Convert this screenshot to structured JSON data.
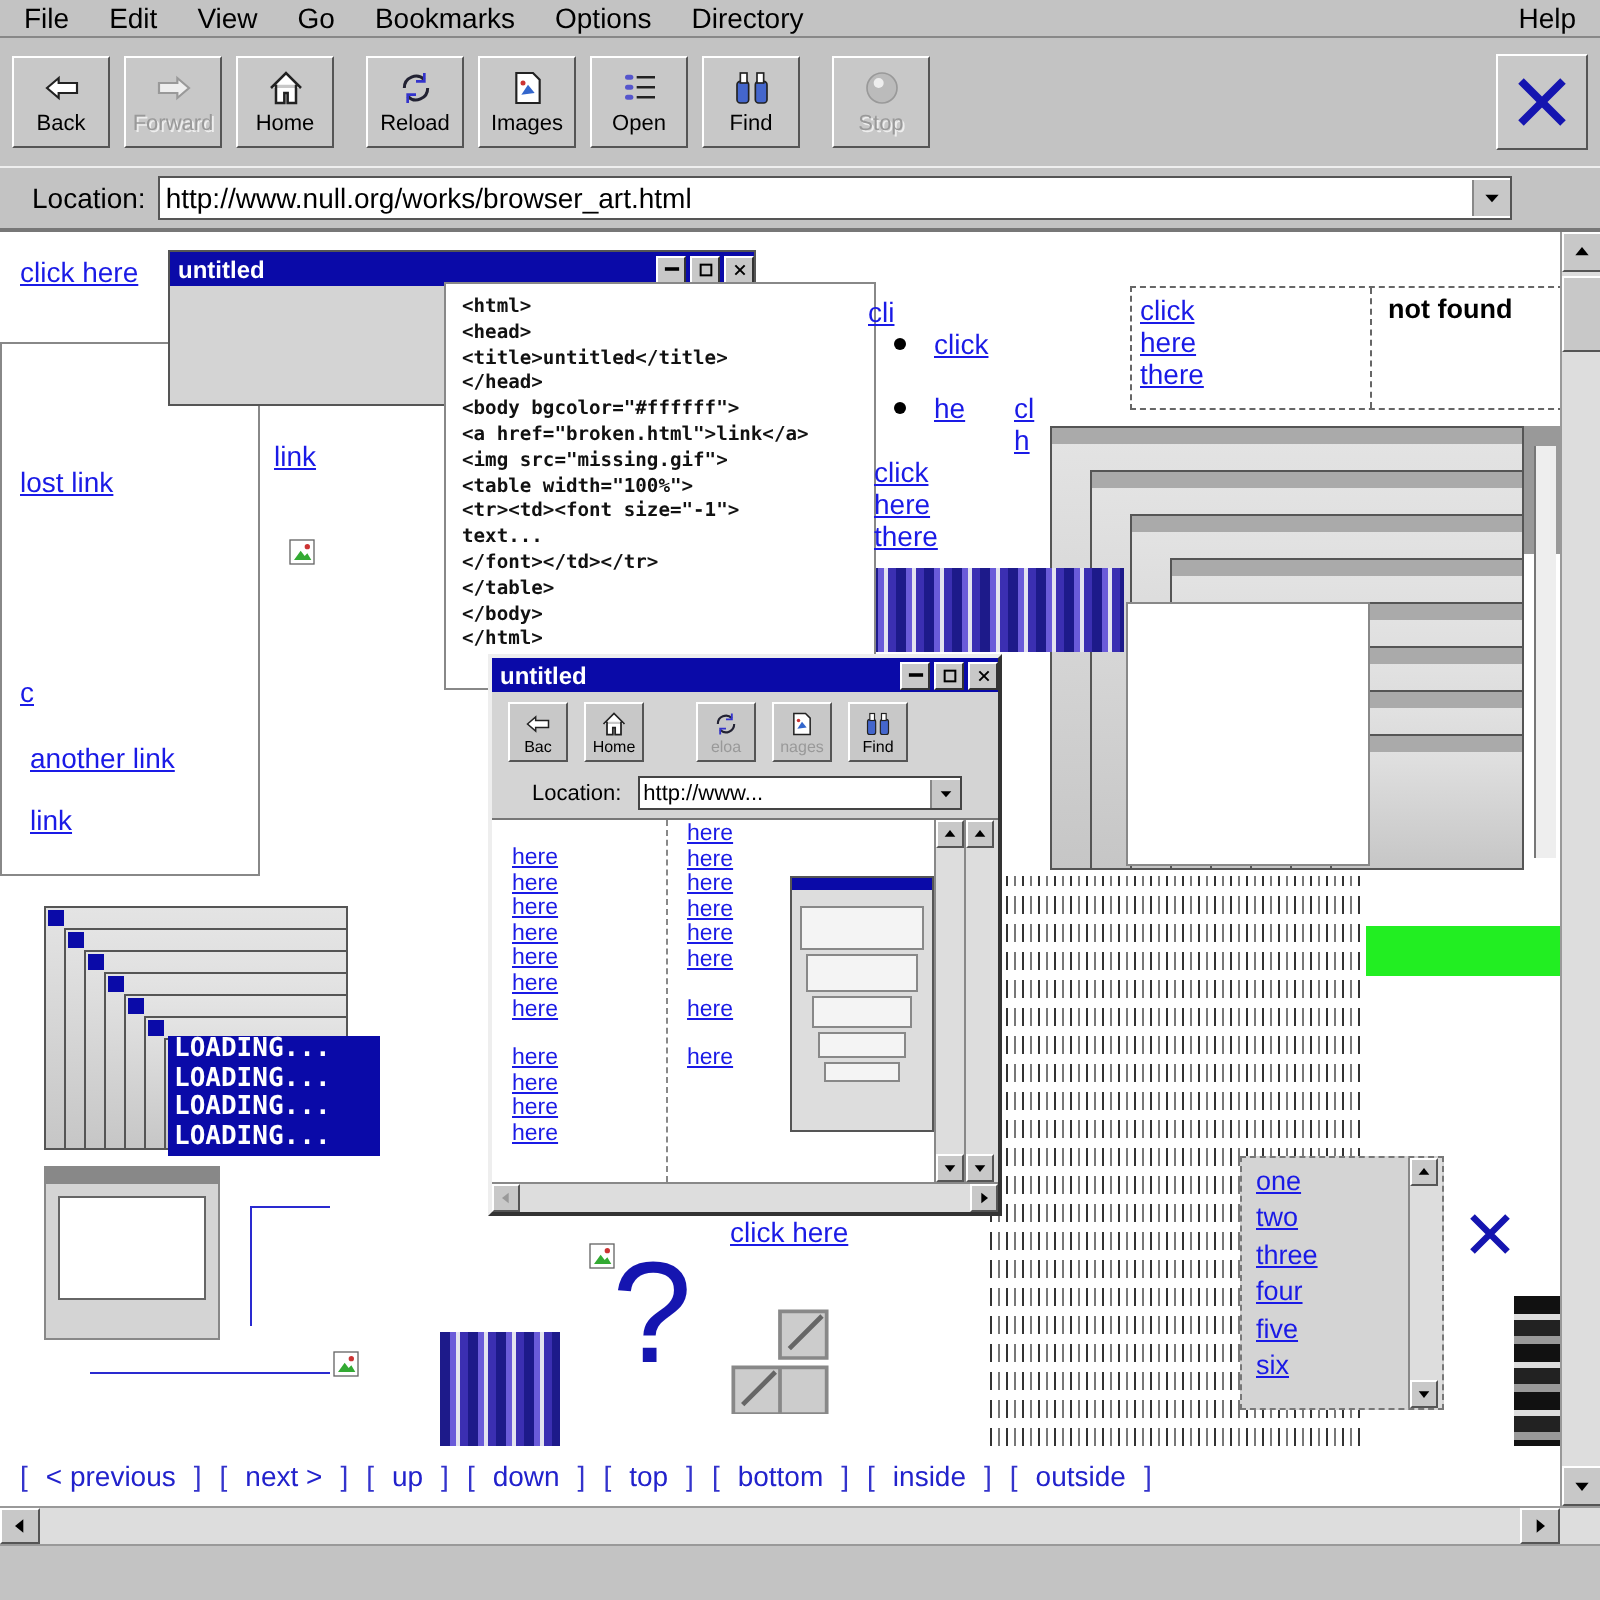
{
  "menu": [
    {
      "label": "File"
    },
    {
      "label": "Edit"
    },
    {
      "label": "View"
    },
    {
      "label": "Go"
    },
    {
      "label": "Bookmarks"
    },
    {
      "label": "Options"
    },
    {
      "label": "Directory"
    },
    {
      "label": "Help"
    }
  ],
  "toolbar": {
    "buttons": [
      {
        "label": "Back",
        "kind": "back",
        "disabled": false
      },
      {
        "label": "Forward",
        "kind": "forward",
        "disabled": true
      },
      {
        "label": "Home",
        "kind": "home",
        "disabled": false
      },
      {
        "label": "Reload",
        "kind": "reload",
        "disabled": false
      },
      {
        "label": "Images",
        "kind": "images",
        "disabled": false
      },
      {
        "label": "Open",
        "kind": "open",
        "disabled": false
      },
      {
        "label": "Find",
        "kind": "find",
        "disabled": false
      },
      {
        "label": "Stop",
        "kind": "stop",
        "disabled": true
      }
    ]
  },
  "location": {
    "label": "Location:",
    "value": "http://www.null.org/works/browser_art.html"
  },
  "collage": {
    "links": [
      {
        "text": "click here",
        "bullet": false
      },
      {
        "text": "lost link",
        "bullet": false
      },
      {
        "text": "link",
        "bullet": false
      },
      {
        "text": "c",
        "bullet": false
      },
      {
        "text": "another link",
        "bullet": false
      },
      {
        "text": "link",
        "bullet": false
      },
      {
        "text": "cli",
        "bullet": false
      },
      {
        "text": "click",
        "bullet": true
      },
      {
        "text": "he",
        "bullet": true
      },
      {
        "text": "cl",
        "bullet": false
      },
      {
        "text": "h",
        "bullet": false
      },
      {
        "text": "click",
        "bullet": false
      },
      {
        "text": "here",
        "bullet": false
      },
      {
        "text": "there",
        "bullet": false
      },
      {
        "text": "click here",
        "bullet": false
      }
    ],
    "small_window": {
      "title": "untitled"
    },
    "code_lines": [
      "<html>",
      "<head>",
      "<title>untitled</title>",
      "</head>",
      "<body bgcolor=\"#ffffff\">",
      "<a href=\"broken.html\">link</a>",
      "<img src=\"missing.gif\">",
      "<table width=\"100%\">",
      "<tr><td><font size=\"-1\">",
      "text...",
      "</font></td></tr>",
      "</table>",
      "</body>",
      "</html>"
    ],
    "table": {
      "links": [
        "click",
        "here",
        "there"
      ],
      "note": "not found"
    },
    "window": {
      "title": "untitled",
      "buttons": [
        {
          "label": "Bac",
          "kind": "back",
          "disabled": false
        },
        {
          "label": "Home",
          "kind": "home",
          "disabled": false
        },
        {
          "label": "eloa",
          "kind": "reload",
          "disabled": true
        },
        {
          "label": "nages",
          "kind": "images",
          "disabled": true
        },
        {
          "label": "Find",
          "kind": "find",
          "disabled": false
        }
      ],
      "location_label": "Location:",
      "location_value": "http://www...",
      "column_1": [
        [
          "here",
          "here",
          "here",
          "here",
          "here",
          "here",
          "here"
        ],
        [
          "here",
          "here",
          "here",
          "here"
        ]
      ],
      "column_2": [
        [
          "here",
          "here",
          "here",
          "here",
          "here",
          "here"
        ],
        [
          "here"
        ],
        [
          "here"
        ]
      ]
    },
    "loading": [
      "LOADING...",
      "LOADING...",
      "LOADING...",
      "LOADING..."
    ],
    "list": [
      "one",
      "two",
      "three",
      "four",
      "five",
      "six"
    ],
    "question": "?"
  },
  "nav": {
    "bracket_open": "[",
    "bracket_close": "]",
    "links": [
      "< previous",
      "next >",
      "up",
      "down",
      "top",
      "bottom",
      "inside",
      "outside"
    ]
  }
}
